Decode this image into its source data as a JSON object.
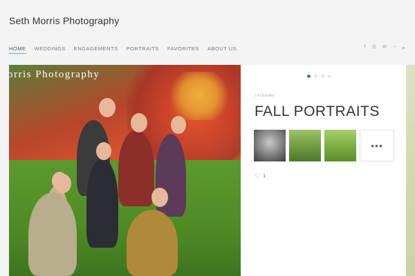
{
  "site": {
    "title": "Seth Morris Photography"
  },
  "nav": {
    "items": [
      {
        "label": "HOME",
        "active": true
      },
      {
        "label": "WEDDINGS",
        "active": false
      },
      {
        "label": "ENGAGEMENTS",
        "active": false
      },
      {
        "label": "PORTRAITS",
        "active": false
      },
      {
        "label": "FAVORITES",
        "active": false
      },
      {
        "label": "ABOUT US",
        "active": false
      }
    ]
  },
  "social": {
    "icons": [
      "facebook-icon",
      "menu-icon",
      "mail-icon",
      "rss-icon",
      "search-icon"
    ],
    "glyphs": {
      "facebook": "f",
      "menu": "☰",
      "mail": "✉",
      "rss": "◔",
      "search": "⌕"
    }
  },
  "photo": {
    "caption": "orris Photography"
  },
  "post": {
    "date": "14 October",
    "title": "FALL PORTRAITS",
    "more_label": "•••",
    "likes": "1",
    "heart": "♡"
  },
  "slider": {
    "dot_count": 4,
    "active_index": 0
  },
  "colors": {
    "accent": "#2f7fc1",
    "heart": "#d9534f"
  }
}
